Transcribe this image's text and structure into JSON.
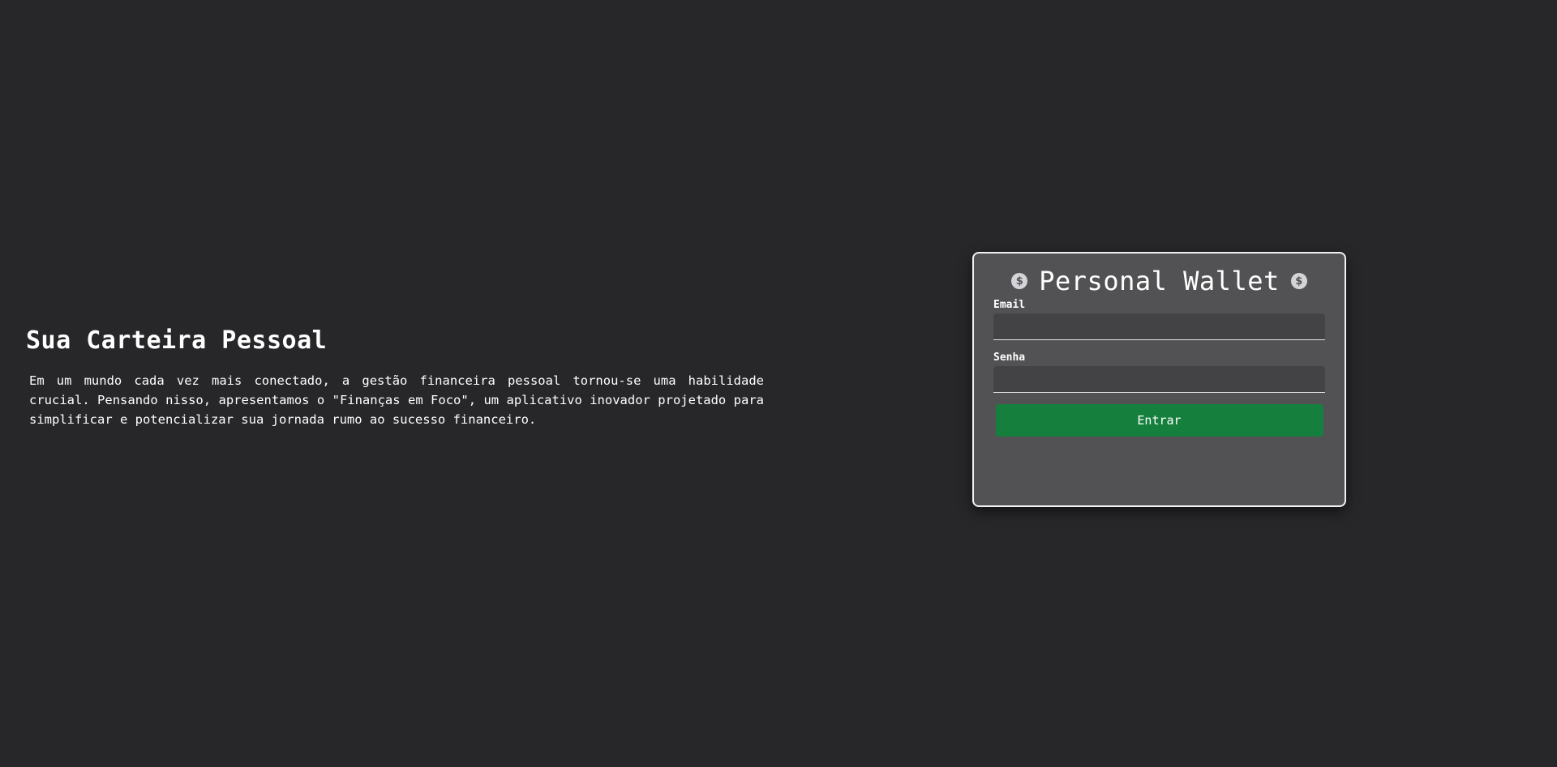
{
  "intro": {
    "title": "Sua Carteira Pessoal",
    "text": "Em um mundo cada vez mais conectado, a gestão financeira pessoal tornou-se uma habilidade crucial. Pensando nisso, apresentamos o \"Finanças em Foco\", um aplicativo inovador projetado para simplificar e potencializar sua jornada rumo ao sucesso financeiro."
  },
  "login": {
    "title": "Personal Wallet",
    "icon_left": "dollar-circle-icon",
    "icon_right": "dollar-circle-icon",
    "icon_glyph": "$",
    "email": {
      "label": "Email",
      "value": "",
      "placeholder": ""
    },
    "password": {
      "label": "Senha",
      "value": "",
      "placeholder": ""
    },
    "submit_label": "Entrar"
  },
  "colors": {
    "background": "#27272a",
    "card": "#525254",
    "input": "#434345",
    "button": "#15803d",
    "text": "#ffffff"
  }
}
